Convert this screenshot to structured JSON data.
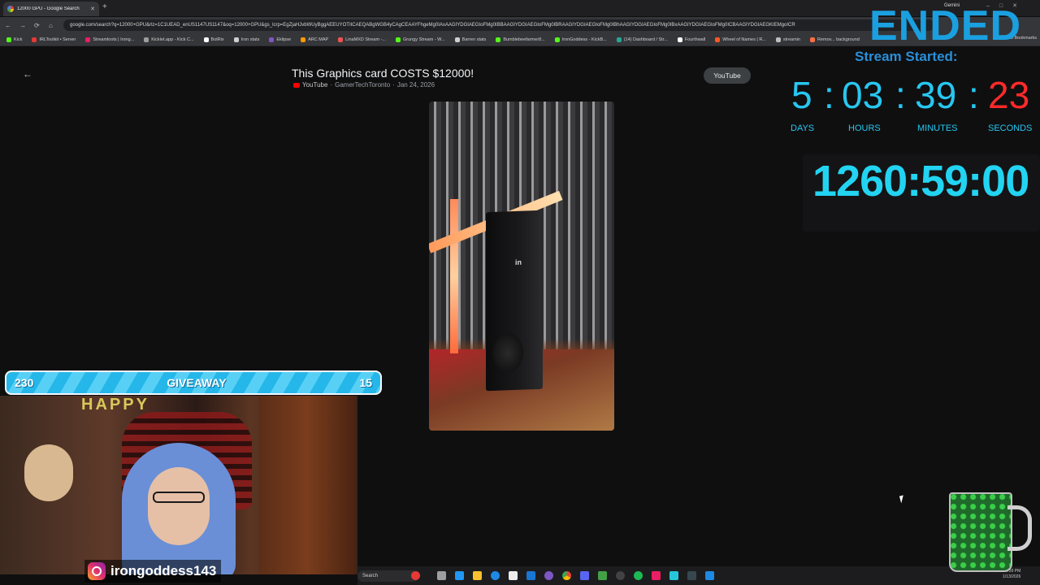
{
  "browser": {
    "tab_title": "12000 GPU - Google Search",
    "newtab_icon": "+",
    "gemini_label": "Gemini",
    "url": "google.com/search?q=12000+GPU&rlz=1C1UEAD_enUS1147US1147&oq=12000+GPU&gs_lcrp=EgZjaHJvbWUyBggAEEUYOTIICAEQABgWGB4yCAgCEAAYFhgeMg0IAxAAGIYDGIAEGIoFMg0IBBAAGIYDGIAEGIoFMg0IBRAAGIYDGIAEGIoFMg0IBhAAGIYDGIAEGIoFMg0IBxAAGIYDGIAEGIoFMg0ICBAAGIYDGIAEGKIEMgoICR",
    "bookmarks": [
      {
        "label": "Kick",
        "color": "#53fc18"
      },
      {
        "label": "IRLToolkit • Server",
        "color": "#e53935"
      },
      {
        "label": "Streamloots | Irong...",
        "color": "#e91e63"
      },
      {
        "label": "Kicklet.app - Kick C...",
        "color": "#9e9e9e"
      },
      {
        "label": "BotRix",
        "color": "#ffffff"
      },
      {
        "label": "Iron stats",
        "color": "#cfcfcf"
      },
      {
        "label": "Eklipse",
        "color": "#7e57c2"
      },
      {
        "label": "ARC MAP",
        "color": "#ff9800"
      },
      {
        "label": "LinaMXD Stream -...",
        "color": "#ef5350"
      },
      {
        "label": "Grungy Stream - W...",
        "color": "#53fc18"
      },
      {
        "label": "Barren stats",
        "color": "#cfcfcf"
      },
      {
        "label": "Bumblebeefarmer8...",
        "color": "#53fc18"
      },
      {
        "label": "IronGoddess - KickB...",
        "color": "#53fc18"
      },
      {
        "label": "(14) Dashboard / Str...",
        "color": "#26a69a"
      },
      {
        "label": "Fourthwall",
        "color": "#ffffff"
      },
      {
        "label": "Wheel of Names | R...",
        "color": "#ff5722"
      },
      {
        "label": "streamin",
        "color": "#bdbdbd"
      },
      {
        "label": "Remov... background",
        "color": "#ff7043"
      }
    ],
    "all_bookmarks": "All Bookmarks"
  },
  "page": {
    "back_icon": "arrow-left-icon",
    "video_title": "This Graphics card COSTS $12000!",
    "source": "YouTube",
    "channel": "GamerTechToronto",
    "separator": "·",
    "date": "Jan 24, 2026",
    "youtube_button": "YouTube",
    "video_logo": "in"
  },
  "overlay": {
    "ended": "ENDED",
    "stream_started": "Stream Started:",
    "countdown": {
      "days": "5",
      "hours": "03",
      "minutes": "39",
      "seconds": "23",
      "sep": ":",
      "labels": {
        "days": "DAYS",
        "hours": "HOURS",
        "minutes": "MINUTES",
        "seconds": "SECONDS"
      }
    },
    "timer": "1260:59:00",
    "giveaway": {
      "left": "230",
      "label": "GIVEAWAY",
      "right": "15"
    },
    "cam_banner": "HAPPY",
    "instagram": "irongoddess143"
  },
  "taskbar": {
    "search": "Search",
    "clock_time": "4:39 PM",
    "clock_date": "1/13/2026"
  },
  "colors": {
    "accent_cyan": "#27c7f0",
    "seconds_red": "#ff2a2a",
    "ended_blue": "#1aa0e0"
  }
}
